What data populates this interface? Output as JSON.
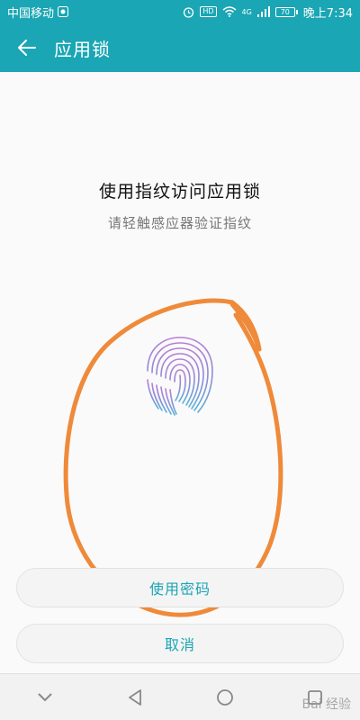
{
  "status_bar": {
    "carrier": "中国移动",
    "hd_badge": "HD",
    "signal_type": "4G",
    "battery": "70",
    "time": "晚上7:34"
  },
  "app_bar": {
    "title": "应用锁",
    "back_icon": "arrow-left-icon"
  },
  "main": {
    "title": "使用指纹访问应用锁",
    "subtitle": "请轻触感应器验证指纹",
    "fingerprint_icon": "fingerprint-icon"
  },
  "buttons": {
    "use_password": "使用密码",
    "cancel": "取消"
  },
  "nav_bar": {
    "items": [
      "chevron-down-icon",
      "back-triangle-icon",
      "home-circle-icon",
      "recent-square-icon"
    ]
  },
  "watermark": "Bai 经验",
  "colors": {
    "accent": "#1aa6b4",
    "annotation": "#ef8a3a"
  }
}
